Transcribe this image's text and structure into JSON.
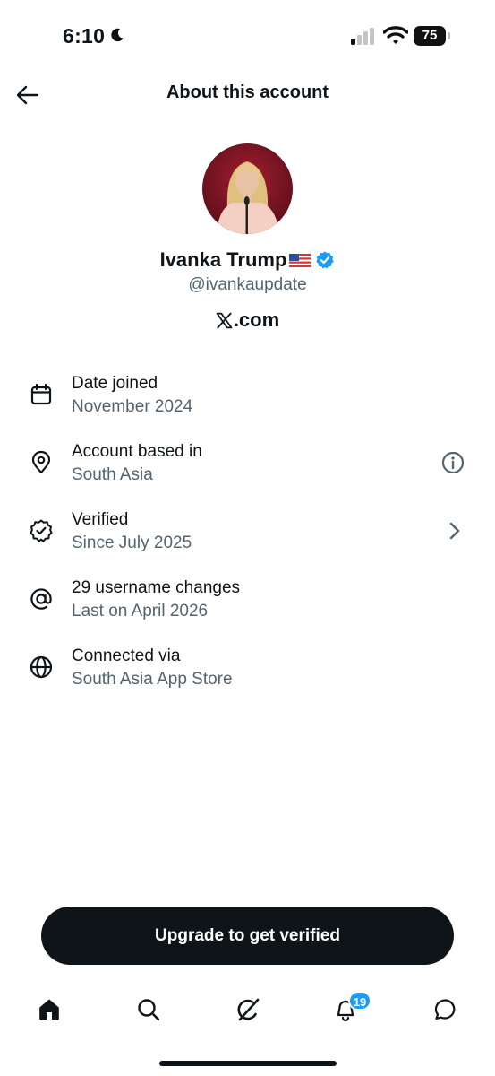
{
  "status_bar": {
    "time": "6:10",
    "battery": "75"
  },
  "header": {
    "title": "About this account"
  },
  "profile": {
    "name": "Ivanka Trump",
    "flag": "🇺🇸",
    "handle": "@ivankaupdate",
    "platform": ".com"
  },
  "info_rows": [
    {
      "icon": "calendar-icon",
      "label": "Date joined",
      "value": "November 2024"
    },
    {
      "icon": "location-pin-icon",
      "label": "Account based in",
      "value": "South Asia",
      "action": "info-icon"
    },
    {
      "icon": "verified-badge-icon",
      "label": "Verified",
      "value": "Since July 2025",
      "action": "chevron-right-icon"
    },
    {
      "icon": "at-sign-icon",
      "label": "29 username changes",
      "value": "Last on April 2026"
    },
    {
      "icon": "globe-icon",
      "label": "Connected via",
      "value": "South Asia App Store"
    }
  ],
  "upgrade_button": {
    "label": "Upgrade to get verified"
  },
  "bottom_nav": {
    "items": [
      "home-icon",
      "search-icon",
      "grok-icon",
      "notifications-bell-icon",
      "messages-icon"
    ],
    "notification_count": "19"
  },
  "colors": {
    "text": "#0f1419",
    "secondary": "#536471",
    "accent": "#1d9bf0"
  }
}
